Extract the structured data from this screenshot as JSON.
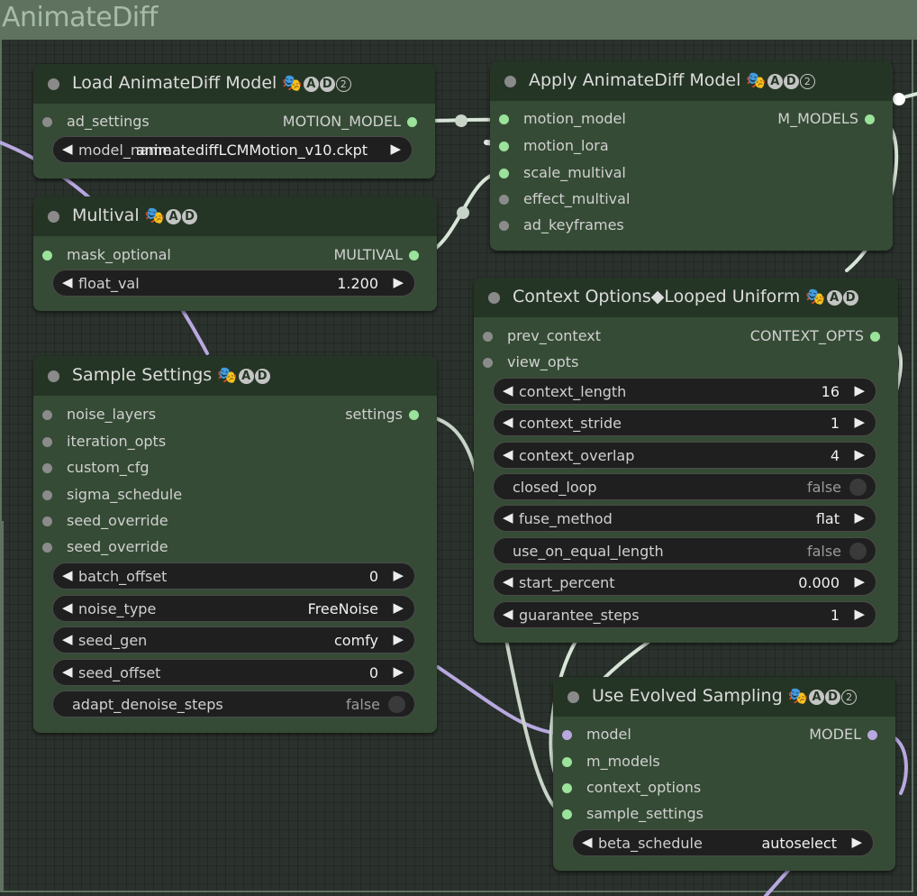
{
  "group": {
    "title": "AnimateDiff"
  },
  "badges": {
    "mask": "🎭",
    "a": "A",
    "d": "D",
    "two": "2"
  },
  "colors": {
    "node_body": "#354b35",
    "node_title": "#253525",
    "slot_connected": "#9be39b",
    "slot_model": "#b8a8e0"
  },
  "nodes": {
    "load_model": {
      "title": "Load AnimateDiff Model",
      "input": "ad_settings",
      "output": "MOTION_MODEL",
      "widget": {
        "label": "model_name",
        "value": "animatediffLCMMotion_v10.ckpt"
      }
    },
    "apply_model": {
      "title": "Apply AnimateDiff Model",
      "inputs": [
        "motion_model",
        "motion_lora",
        "scale_multival",
        "effect_multival",
        "ad_keyframes"
      ],
      "output": "M_MODELS"
    },
    "multival": {
      "title": "Multival",
      "input": "mask_optional",
      "output": "MULTIVAL",
      "widget": {
        "label": "float_val",
        "value": "1.200"
      }
    },
    "sample_settings": {
      "title": "Sample Settings",
      "inputs": [
        "noise_layers",
        "iteration_opts",
        "custom_cfg",
        "sigma_schedule",
        "seed_override",
        "seed_override"
      ],
      "output": "settings",
      "widgets": [
        {
          "label": "batch_offset",
          "value": "0"
        },
        {
          "label": "noise_type",
          "value": "FreeNoise"
        },
        {
          "label": "seed_gen",
          "value": "comfy"
        },
        {
          "label": "seed_offset",
          "value": "0"
        }
      ],
      "toggle": {
        "label": "adapt_denoise_steps",
        "value": "false"
      }
    },
    "context_options": {
      "title": "Context Options◆Looped Uniform",
      "inputs": [
        "prev_context",
        "view_opts"
      ],
      "output": "CONTEXT_OPTS",
      "widgets": [
        {
          "label": "context_length",
          "value": "16"
        },
        {
          "label": "context_stride",
          "value": "1"
        },
        {
          "label": "context_overlap",
          "value": "4"
        },
        {
          "label": "closed_loop",
          "value": "false"
        },
        {
          "label": "fuse_method",
          "value": "flat"
        },
        {
          "label": "use_on_equal_length",
          "value": "false"
        },
        {
          "label": "start_percent",
          "value": "0.000"
        },
        {
          "label": "guarantee_steps",
          "value": "1"
        }
      ]
    },
    "evolved_sampling": {
      "title": "Use Evolved Sampling",
      "inputs": [
        "model",
        "m_models",
        "context_options",
        "sample_settings"
      ],
      "output": "MODEL",
      "widget": {
        "label": "beta_schedule",
        "value": "autoselect"
      }
    }
  }
}
